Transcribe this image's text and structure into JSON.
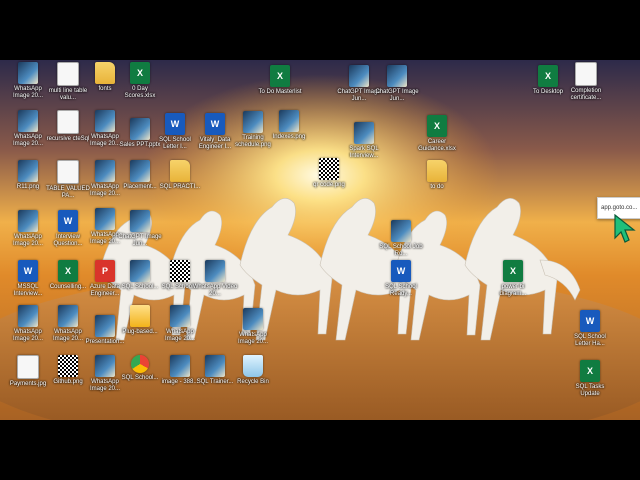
{
  "desktop": {
    "icons": [
      {
        "label": "WhatsApp Image 20...",
        "type": "image"
      },
      {
        "label": "multi line table valu...",
        "type": "doc"
      },
      {
        "label": "fonts",
        "type": "folder"
      },
      {
        "label": "0 Day Scores.xlsx",
        "type": "excel"
      },
      {
        "label": "To Do Masterlist",
        "type": "excel"
      },
      {
        "label": "ChatGPT Image Jun...",
        "type": "image"
      },
      {
        "label": "ChatGPT Image Jun...",
        "type": "image"
      },
      {
        "label": "To Desktop",
        "type": "excel"
      },
      {
        "label": "Completion certificate...",
        "type": "doc"
      },
      {
        "label": "WhatsApp Image 20...",
        "type": "image"
      },
      {
        "label": "recursive cteSql",
        "type": "doc"
      },
      {
        "label": "WhatsApp Image 20...",
        "type": "image"
      },
      {
        "label": "Sales PPT.pptx",
        "type": "image"
      },
      {
        "label": "SQL School Letter I...",
        "type": "word"
      },
      {
        "label": "Vitaly_Data Engineer I...",
        "type": "word"
      },
      {
        "label": "Training schedule.png",
        "type": "image"
      },
      {
        "label": "Indexes.png",
        "type": "image"
      },
      {
        "label": "Spark SQL Interview...",
        "type": "image"
      },
      {
        "label": "Career Guidance.xlsx",
        "type": "excel"
      },
      {
        "label": "R11.png",
        "type": "image"
      },
      {
        "label": "TABLE VALUED PA...",
        "type": "doc"
      },
      {
        "label": "WhatsApp Image 20...",
        "type": "image"
      },
      {
        "label": "Placement...",
        "type": "image"
      },
      {
        "label": "SQL PRACTI...",
        "type": "folder"
      },
      {
        "label": "qr code.png",
        "type": "qr"
      },
      {
        "label": "to do",
        "type": "folder"
      },
      {
        "label": "WhatsApp Image 20...",
        "type": "image"
      },
      {
        "label": "Interview Question...",
        "type": "word"
      },
      {
        "label": "WhatsApp Image 20...",
        "type": "image"
      },
      {
        "label": "ChatGPT Image Jun...",
        "type": "image"
      },
      {
        "label": "SQL School Job Ro...",
        "type": "image"
      },
      {
        "label": "MSSQL Interview...",
        "type": "word"
      },
      {
        "label": "Counselling...",
        "type": "excel"
      },
      {
        "label": "Azure Data Engineer...",
        "type": "pdf"
      },
      {
        "label": "SQL School...",
        "type": "image"
      },
      {
        "label": "SQL School...",
        "type": "qr"
      },
      {
        "label": "WhatsApp Video 20...",
        "type": "image"
      },
      {
        "label": "SQL School Ready...",
        "type": "word"
      },
      {
        "label": "power bi diagram...",
        "type": "excel"
      },
      {
        "label": "WhatsApp Image 20...",
        "type": "image"
      },
      {
        "label": "WhatsApp Image 20...",
        "type": "image"
      },
      {
        "label": "Presentation...",
        "type": "image"
      },
      {
        "label": "Plug-based...",
        "type": "lock"
      },
      {
        "label": "WhatsApp Image 20...",
        "type": "image"
      },
      {
        "label": "WhatsApp Image 20...",
        "type": "image"
      },
      {
        "label": "SQL School Letter Ha...",
        "type": "word"
      },
      {
        "label": "Payments.jpg",
        "type": "doc"
      },
      {
        "label": "Github.png",
        "type": "qr"
      },
      {
        "label": "WhatsApp Image 20...",
        "type": "image"
      },
      {
        "label": "SQL School...",
        "type": "chrome"
      },
      {
        "label": "image - 388...",
        "type": "image"
      },
      {
        "label": "SQL Trainer...",
        "type": "image"
      },
      {
        "label": "Recycle Bin",
        "type": "bin"
      },
      {
        "label": "SQL Tasks Update",
        "type": "excel"
      }
    ]
  },
  "popup": {
    "text": "app.goto.co..."
  },
  "colors": {
    "sky_top": "#3b2a4d",
    "sun": "#fff3b0",
    "sand": "#c27a2c",
    "horse": "#f2f0ec"
  }
}
